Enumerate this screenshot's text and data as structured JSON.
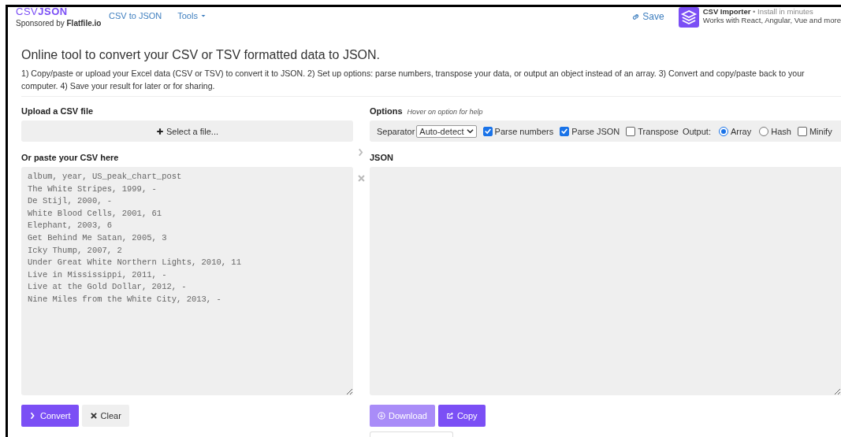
{
  "header": {
    "logo": {
      "light": "CSV",
      "bold": "JSON"
    },
    "sponsor": "Sponsored by **Flatfile.io**",
    "nav": [
      {
        "label": "CSV to JSON",
        "kind": "link"
      },
      {
        "label": "Tools",
        "kind": "dropdown"
      }
    ],
    "save": "Save",
    "promo": {
      "title": "CSV Importer",
      "tagline": "• Install in minutes",
      "subtitle": "Works with React, Angular, Vue and more"
    }
  },
  "intro": {
    "title": "Online tool to convert your CSV or TSV formatted data to JSON.",
    "text": "1) Copy/paste or upload your Excel data (CSV or TSV) to convert it to JSON. 2) Set up options: parse numbers, transpose your data, or output an object instead of an array. 3) Convert and copy/paste back to your computer. 4) Save your result for later or for sharing."
  },
  "upload": {
    "label": "Upload a CSV file",
    "button": "Select a file..."
  },
  "options": {
    "label": "Options",
    "hint": "Hover on option for help",
    "items": [
      {
        "kind": "select",
        "label": "Separator",
        "value": "Auto-detect"
      },
      {
        "kind": "checkbox",
        "label": "Parse numbers",
        "checked": true
      },
      {
        "kind": "checkbox",
        "label": "Parse JSON",
        "checked": true
      },
      {
        "kind": "checkbox",
        "label": "Transpose",
        "checked": false
      },
      {
        "kind": "text",
        "label": "Output:"
      },
      {
        "kind": "radio",
        "label": "Array",
        "selected": true
      },
      {
        "kind": "radio",
        "label": "Hash",
        "selected": false
      },
      {
        "kind": "checkbox",
        "label": "Minify",
        "checked": false
      }
    ]
  },
  "csv": {
    "label": "Or paste your CSV here",
    "lines": [
      "album, year, US_peak_chart_post",
      "The White Stripes, 1999, -",
      "De Stijl, 2000, -",
      "White Blood Cells, 2001, 61",
      "Elephant, 2003, 6",
      "Get Behind Me Satan, 2005, 3",
      "Icky Thump, 2007, 2",
      "Under Great White Northern Lights, 2010, 11",
      "Live in Mississippi, 2011, -",
      "Live at the Gold Dollar, 2012, -",
      "Nine Miles from the White City, 2013, -"
    ]
  },
  "json": {
    "label": "JSON"
  },
  "left_buttons": [
    {
      "kind": "convert",
      "label": "Convert"
    },
    {
      "kind": "clear",
      "label": "Clear"
    }
  ],
  "right_buttons": [
    {
      "kind": "download",
      "label": "Download",
      "disabled": true
    },
    {
      "kind": "copy",
      "label": "Copy",
      "disabled": false
    }
  ]
}
